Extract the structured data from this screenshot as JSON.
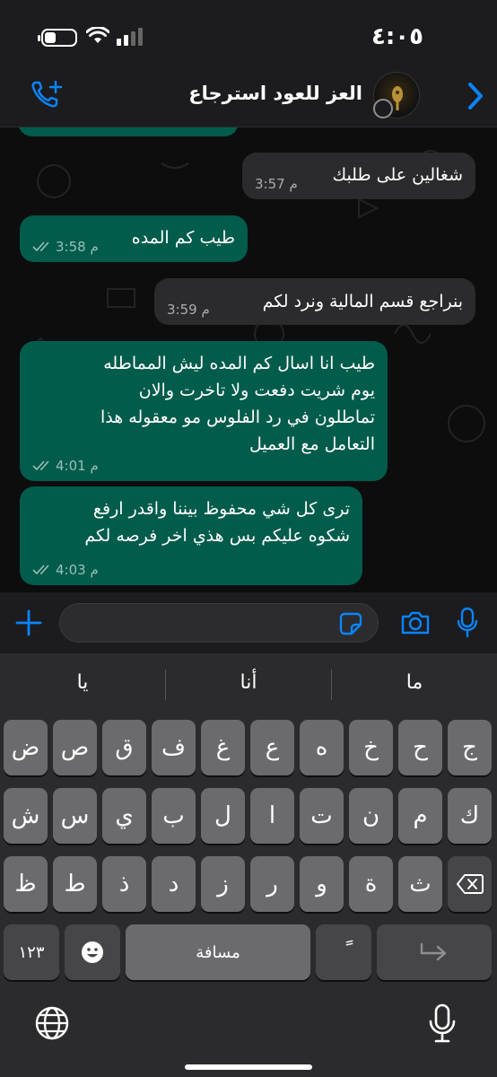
{
  "status_bar": {
    "time": "٤:٠٥"
  },
  "header": {
    "contact_name": "العز للعود استرجاع"
  },
  "messages": [
    {
      "direction": "in",
      "text": "شغالين على طلبك",
      "time": "3:57 م"
    },
    {
      "direction": "out",
      "text": "طيب كم المده",
      "time": "3:58 م"
    },
    {
      "direction": "in",
      "text": "بنراجع قسم المالية ونرد لكم",
      "time": "3:59 م"
    },
    {
      "direction": "out",
      "text": "طيب انا اسال كم المده ليش المماطله\nيوم شريت دفعت ولا تاخرت والان\nتماطلون في رد الفلوس  مو معقوله هذا\nالتعامل مع العميل",
      "time": "4:01 م"
    },
    {
      "direction": "out",
      "text": "ترى كل شي محفوظ بيننا واقدر  ارفع\nشكوه عليكم بس هذي اخر فرصه لكم",
      "time": "4:03 م"
    }
  ],
  "input": {
    "placeholder": ""
  },
  "keyboard": {
    "suggestions": [
      "ما",
      "أنا",
      "يا"
    ],
    "row1": [
      "ج",
      "ح",
      "خ",
      "ه",
      "ع",
      "غ",
      "ف",
      "ق",
      "ص",
      "ض"
    ],
    "row2": [
      "ك",
      "م",
      "ن",
      "ت",
      "ا",
      "ل",
      "ب",
      "ي",
      "س",
      "ش"
    ],
    "row3": [
      "ث",
      "ة",
      "و",
      "ر",
      "ز",
      "د",
      "ذ",
      "ط",
      "ظ"
    ],
    "numbers_key": "١٢٣",
    "space_label": "مسافة",
    "tanween_key": "ً"
  },
  "colors": {
    "outgoing_bubble": "#015c4b",
    "incoming_bubble": "#2b2b2d",
    "accent": "#0a84ff"
  },
  "icons": [
    "battery-icon",
    "wifi-icon",
    "signal-icon",
    "back-chevron-icon",
    "add-call-icon",
    "plus-icon",
    "sticker-icon",
    "camera-icon",
    "microphone-icon",
    "globe-icon",
    "emoji-icon",
    "delete-key-icon",
    "return-key-icon",
    "dictation-icon"
  ]
}
